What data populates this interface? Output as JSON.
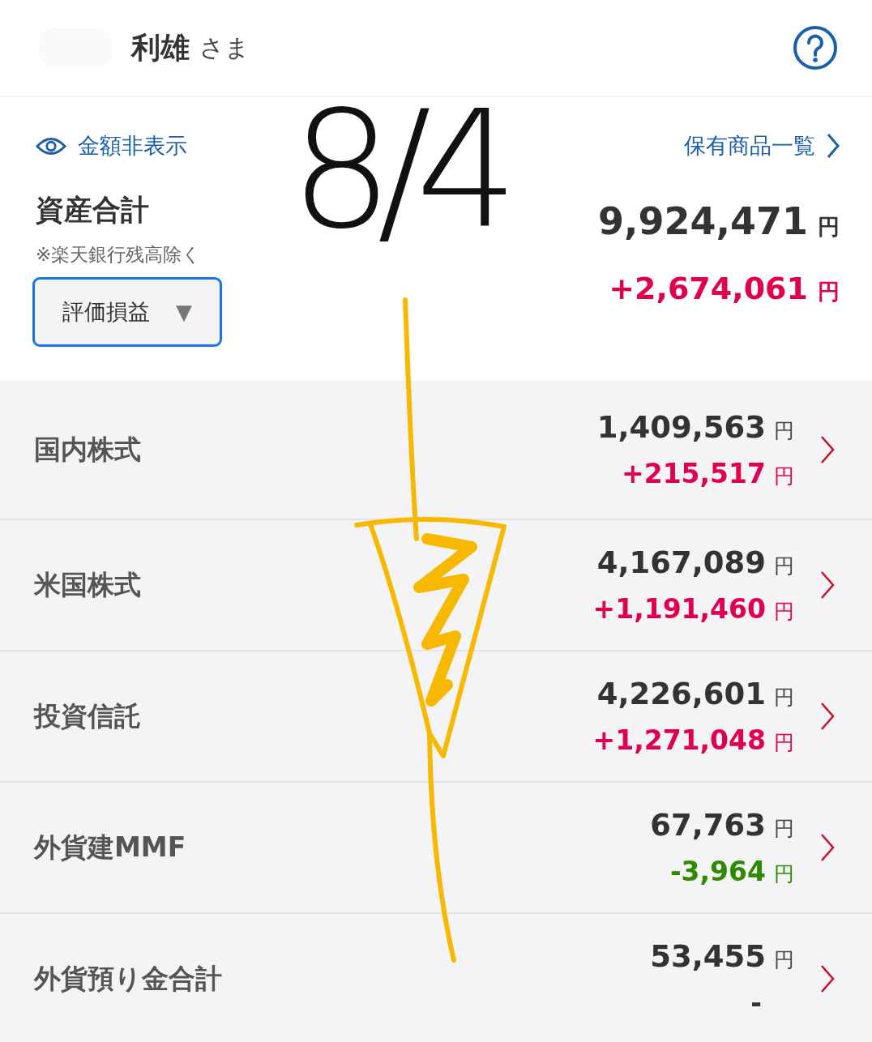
{
  "header": {
    "name": "利雄",
    "honorific": "さま"
  },
  "summary": {
    "hide_amounts_link": "金額非表示",
    "holdings_link": "保有商品一覧",
    "title": "資産合計",
    "note": "※楽天銀行残高除く",
    "dropdown": {
      "value": "評価損益",
      "caret": "▼"
    },
    "total": "9,924,471",
    "total_unit": "円",
    "gain": "+2,674,061",
    "gain_unit": "円"
  },
  "assets": [
    {
      "name": "国内株式",
      "amount": "1,409,563",
      "amount_unit": "円",
      "change": "+215,517",
      "change_unit": "円",
      "color": "#e0004f"
    },
    {
      "name": "米国株式",
      "amount": "4,167,089",
      "amount_unit": "円",
      "change": "+1,191,460",
      "change_unit": "円",
      "color": "#e0004f"
    },
    {
      "name": "投資信託",
      "amount": "4,226,601",
      "amount_unit": "円",
      "change": "+1,271,048",
      "change_unit": "円",
      "color": "#e0004f"
    },
    {
      "name": "外貨建MMF",
      "amount": "67,763",
      "amount_unit": "円",
      "change": "-3,964",
      "change_unit": "円",
      "color": "#2f8a00"
    },
    {
      "name": "外貨預り金合計",
      "amount": "53,455",
      "amount_unit": "円",
      "change": "-",
      "color": "#333333"
    }
  ],
  "annotation": {
    "handwriting": "8/4"
  }
}
